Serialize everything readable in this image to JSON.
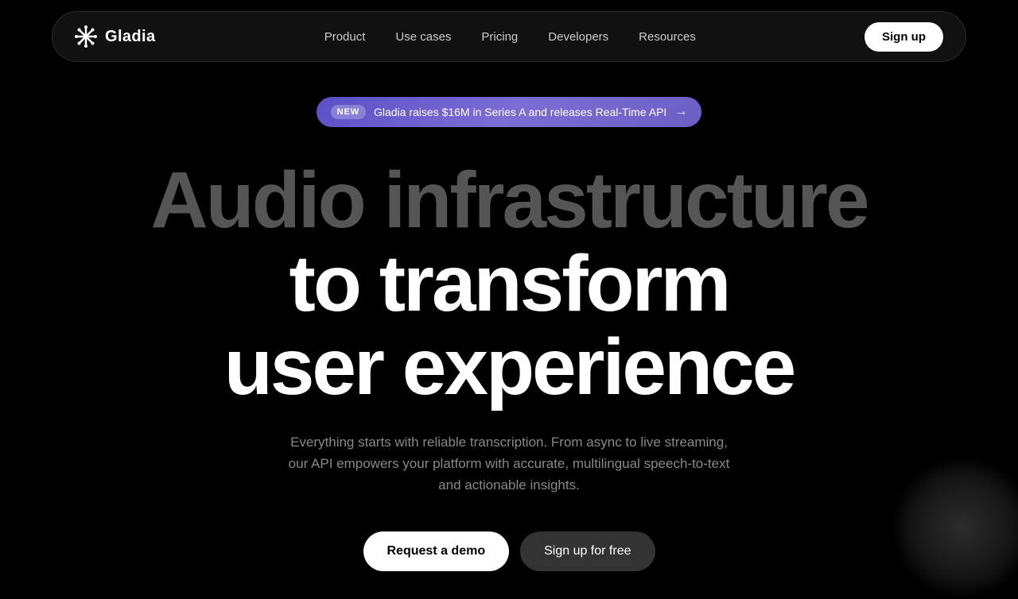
{
  "navbar": {
    "logo_text": "Gladia",
    "links": [
      {
        "label": "Product",
        "id": "product"
      },
      {
        "label": "Use cases",
        "id": "use-cases"
      },
      {
        "label": "Pricing",
        "id": "pricing"
      },
      {
        "label": "Developers",
        "id": "developers"
      },
      {
        "label": "Resources",
        "id": "resources"
      }
    ],
    "signup_label": "Sign up"
  },
  "announcement": {
    "badge_label": "NEW",
    "text": "Gladia raises $16M in Series A and releases Real-Time API",
    "arrow": "→"
  },
  "hero": {
    "line1": "Audio infrastructure",
    "line2": "to transform",
    "line3": "user experience",
    "description": "Everything starts with reliable transcription. From async to live streaming, our API empowers your platform with accurate, multilingual speech-to-text and actionable insights.",
    "cta_demo": "Request a demo",
    "cta_signup": "Sign up for free"
  }
}
